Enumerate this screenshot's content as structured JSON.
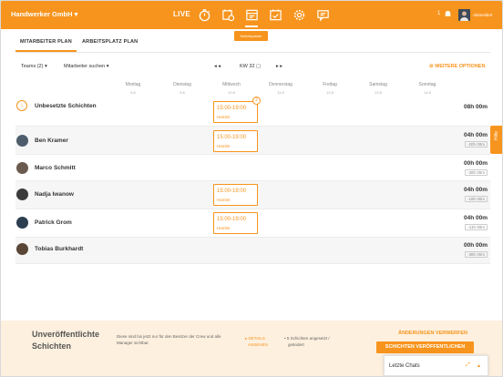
{
  "topbar": {
    "company": "Handwerker GmbH ▾",
    "live": "LIVE",
    "tooltip": "Schichtplaner",
    "notification_count": "1",
    "admin_name": "Abimeldert",
    "icons": [
      "stopwatch-icon",
      "calendar-clock-icon",
      "schedule-icon",
      "calendar-check-icon",
      "settings-icon",
      "chat-icon"
    ]
  },
  "tabs": [
    {
      "label": "MITARBEITER PLAN",
      "active": true
    },
    {
      "label": "ARBEITSPLATZ PLAN",
      "active": false
    }
  ],
  "filters": {
    "teams": "Teams (2) ▾",
    "employee_search": "Mitarbeiter suchen ▾",
    "week_prev": "◂ ◂",
    "week_label": "KW 32 ▢",
    "week_next": "▸ ▸",
    "more_options": "⊘ WEITERE OPTIONEN"
  },
  "days": [
    {
      "name": "Montag",
      "date": "8.8"
    },
    {
      "name": "Dienstag",
      "date": "9.8"
    },
    {
      "name": "Mittwoch",
      "date": "10.8"
    },
    {
      "name": "Donnerstag",
      "date": "11.8"
    },
    {
      "name": "Freitag",
      "date": "12.8"
    },
    {
      "name": "Samstag",
      "date": "13.8"
    },
    {
      "name": "Sonntag",
      "date": "14.8"
    }
  ],
  "rows": [
    {
      "name": "Unbesetzte Schichten",
      "hours": "08h 00m",
      "diff": "",
      "shift": {
        "time": "15:00-19:00",
        "location": "Hamlet",
        "badge": "2"
      }
    },
    {
      "name": "Ben Kramer",
      "hours": "04h 00m",
      "diff": "-20h 00m",
      "shift": {
        "time": "15:00-19:00",
        "location": "Hamlet"
      }
    },
    {
      "name": "Marco Schmitt",
      "hours": "00h 00m",
      "diff": "-38h 00m",
      "shift": null
    },
    {
      "name": "Nadja Iwanow",
      "hours": "04h 00m",
      "diff": "-18h 00m",
      "shift": {
        "time": "15:00-19:00",
        "location": "Hamlet"
      }
    },
    {
      "name": "Patrick Grom",
      "hours": "04h 00m",
      "diff": "-11h 00m",
      "shift": {
        "time": "15:00-19:00",
        "location": "Hamlet"
      }
    },
    {
      "name": "Tobias Burkhardt",
      "hours": "00h 00m",
      "diff": "-38h 00m",
      "shift": null
    }
  ],
  "help_tab": "Hilfe",
  "banner": {
    "title_line1": "Unveröffentlichte",
    "title_line2": "Schichten",
    "description": "Diese sind bis jetzt nur für den Besitzer der Crew und alle Manager sichtbar.",
    "details_line1": "▸ DETAILS",
    "details_line2": "ANSEHEN",
    "count_line1": "• 5 Schichten angesetzt /",
    "count_line2": "geändert",
    "discard": "ÄNDERUNGEN VERWERFEN",
    "publish": "SCHICHTEN VERÖFFENTLICHEN"
  },
  "chats": {
    "label": "Letzte Chats",
    "expand": "⤢",
    "caret": "▴"
  },
  "colors": {
    "accent": "#f7941d",
    "banner": "#fdf0de"
  }
}
